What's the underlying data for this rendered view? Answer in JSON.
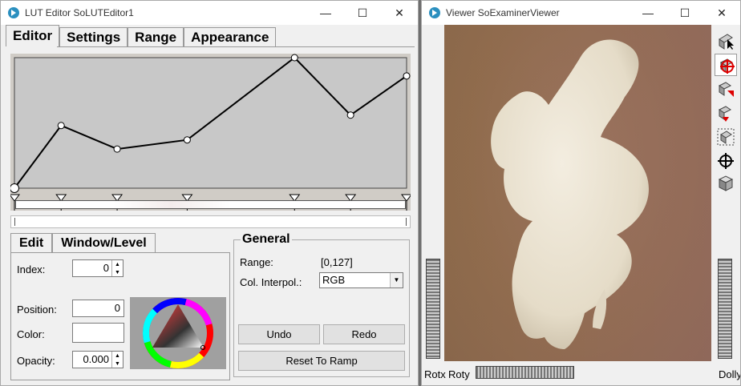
{
  "lut_window": {
    "title": "LUT Editor SoLUTEditor1",
    "controls": {
      "minimize": "—",
      "maximize": "☐",
      "close": "✕"
    },
    "tabs": [
      "Editor",
      "Settings",
      "Range",
      "Appearance"
    ],
    "active_tab": "Editor",
    "curve": {
      "points": [
        [
          0,
          0
        ],
        [
          10,
          0.48
        ],
        [
          22,
          0.3
        ],
        [
          37,
          0.37
        ],
        [
          60,
          1.0
        ],
        [
          72,
          0.56
        ],
        [
          84,
          0.86
        ]
      ],
      "x_max": 84,
      "selected_index": 0
    },
    "sub_tabs": [
      "Edit",
      "Window/Level"
    ],
    "active_sub_tab": "Edit",
    "edit": {
      "index_label": "Index:",
      "index_value": "0",
      "position_label": "Position:",
      "position_value": "0",
      "color_label": "Color:",
      "opacity_label": "Opacity:",
      "opacity_value": "0.000"
    },
    "general": {
      "title": "General",
      "range_label": "Range:",
      "range_value": "[0,127]",
      "interp_label": "Col. Interpol.:",
      "interp_value": "RGB",
      "undo_label": "Undo",
      "redo_label": "Redo",
      "reset_label": "Reset To Ramp"
    }
  },
  "viewer_window": {
    "title": "Viewer SoExaminerViewer",
    "controls": {
      "minimize": "—",
      "maximize": "☐",
      "close": "✕"
    },
    "tools": [
      "pick-arrow-icon",
      "rotate-view-icon",
      "home-icon",
      "set-home-icon",
      "view-all-icon",
      "seek-icon",
      "perspective-cube-icon"
    ],
    "rotx_label": "Rotx",
    "roty_label": "Roty",
    "dolly_label": "Dolly"
  },
  "colors": {
    "curve_bg": "#c8c8c8",
    "render_bg": "#9a7656",
    "bone": "#ede6d6"
  }
}
